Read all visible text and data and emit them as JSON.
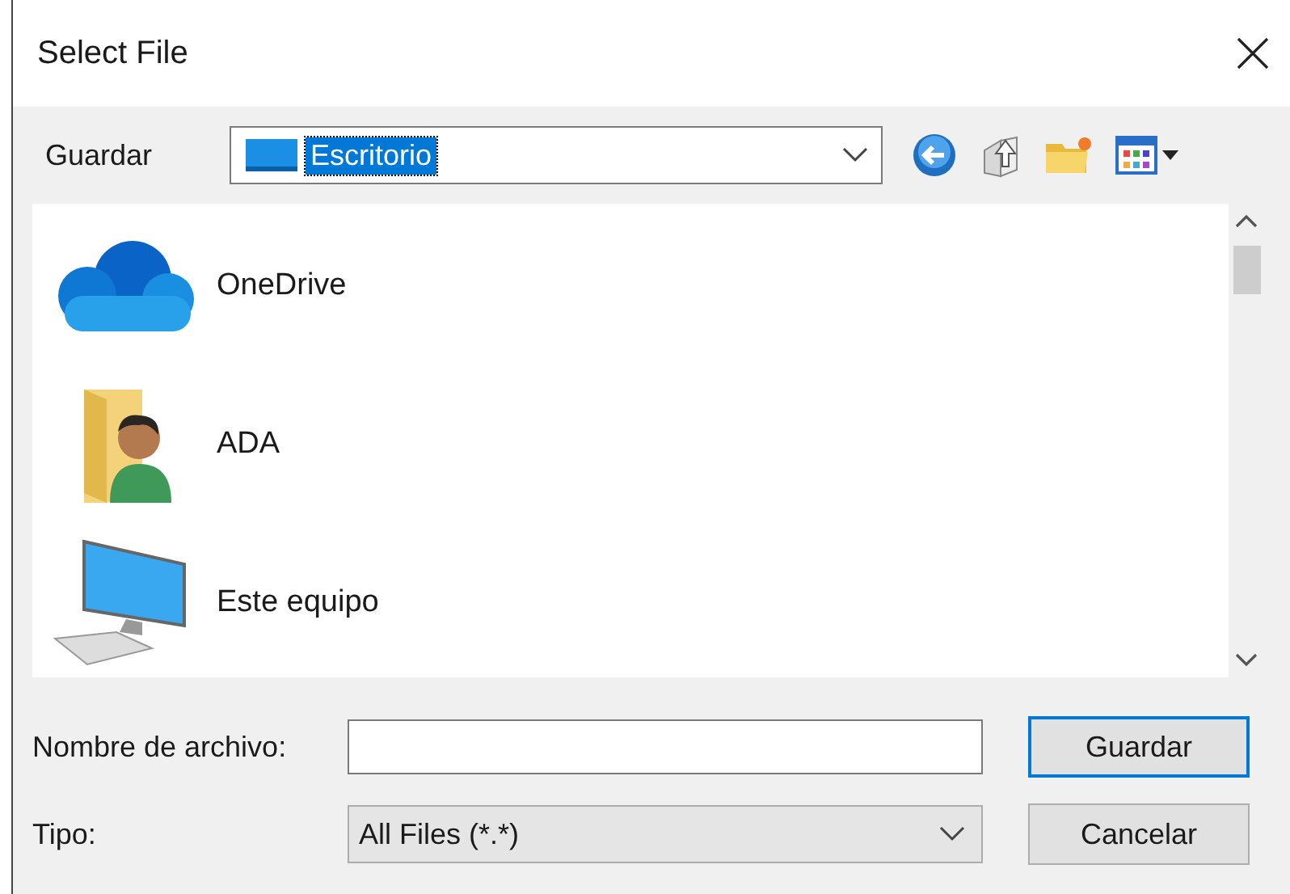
{
  "window": {
    "title": "Select File"
  },
  "location": {
    "label": "Guardar",
    "value": "Escritorio",
    "value_selected": true
  },
  "items": [
    {
      "name": "OneDrive",
      "kind": "cloud"
    },
    {
      "name": "ADA",
      "kind": "user-folder"
    },
    {
      "name": "Este equipo",
      "kind": "computer"
    }
  ],
  "filename": {
    "label": "Nombre de archivo:"
  },
  "file_type": {
    "label": "Tipo:",
    "value": "All Files (*.*)"
  },
  "buttons": [
    {
      "label": "Guardar",
      "default": true
    },
    {
      "label": "Cancelar",
      "default": false
    }
  ]
}
